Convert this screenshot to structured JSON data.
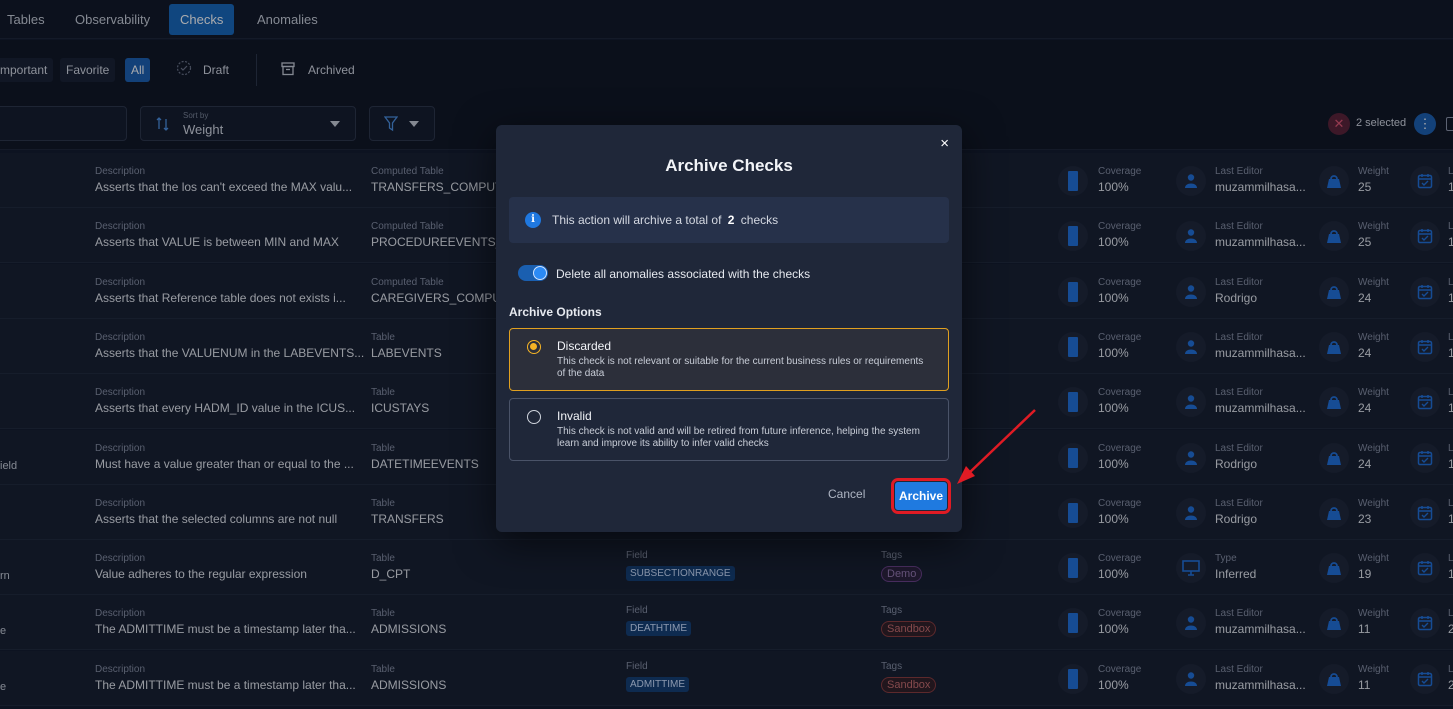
{
  "nav": {
    "tabs": [
      {
        "label": "Tables"
      },
      {
        "label": "Observability"
      },
      {
        "label": "Checks"
      },
      {
        "label": "Anomalies"
      }
    ]
  },
  "filters": {
    "important": "mportant",
    "favorite": "Favorite",
    "all": "All",
    "draft": "Draft",
    "archived": "Archived"
  },
  "toolbar": {
    "sort_label": "Sort by",
    "sort_value": "Weight",
    "selected_count": "2 selected"
  },
  "rows": [
    {
      "left": "",
      "desc": "Asserts that the los can't exceed the MAX valu...",
      "tlabel": "Computed Table",
      "table": "TRANSFERS_COMPUTE",
      "field": "",
      "tag": "",
      "coverage": "100%",
      "elabel": "Last Editor",
      "editor": "muzammilhasa...",
      "weight": "25",
      "flag": "1"
    },
    {
      "left": "",
      "desc": "Asserts that VALUE is between MIN and MAX",
      "tlabel": "Computed Table",
      "table": "PROCEDUREEVENTS_M",
      "field": "",
      "tag": "",
      "coverage": "100%",
      "elabel": "Last Editor",
      "editor": "muzammilhasa...",
      "weight": "25",
      "flag": "1"
    },
    {
      "left": "",
      "desc": "Asserts that Reference table does not exists i...",
      "tlabel": "Computed Table",
      "table": "CAREGIVERS_COMPUT",
      "field": "",
      "tag": "",
      "coverage": "100%",
      "elabel": "Last Editor",
      "editor": "Rodrigo",
      "weight": "24",
      "flag": "1"
    },
    {
      "left": "",
      "desc": "Asserts that the VALUENUM in the LABEVENTS...",
      "tlabel": "Table",
      "table": "LABEVENTS",
      "field": "",
      "tag": "",
      "coverage": "100%",
      "elabel": "Last Editor",
      "editor": "muzammilhasa...",
      "weight": "24",
      "flag": "1"
    },
    {
      "left": "",
      "desc": "Asserts that every HADM_ID value in the ICUS...",
      "tlabel": "Table",
      "table": "ICUSTAYS",
      "field": "",
      "tag": "",
      "coverage": "100%",
      "elabel": "Last Editor",
      "editor": "muzammilhasa...",
      "weight": "24",
      "flag": "1"
    },
    {
      "left": "ield",
      "desc": "Must have a value greater than or equal to the ...",
      "tlabel": "Table",
      "table": "DATETIMEEVENTS",
      "field": "",
      "tag": "",
      "coverage": "100%",
      "elabel": "Last Editor",
      "editor": "Rodrigo",
      "weight": "24",
      "flag": "1"
    },
    {
      "left": "",
      "desc": "Asserts that the selected columns are not null",
      "tlabel": "Table",
      "table": "TRANSFERS",
      "field": "",
      "tag": "",
      "coverage": "100%",
      "elabel": "Last Editor",
      "editor": "Rodrigo",
      "weight": "23",
      "flag": "1"
    },
    {
      "left": "rn",
      "desc": "Value adheres to the regular expression",
      "tlabel": "Table",
      "table": "D_CPT",
      "field": "SUBSECTIONRANGE",
      "tag": "Demo",
      "coverage": "100%",
      "elabel": "Type",
      "editor": "Inferred",
      "weight": "19",
      "flag": "1"
    },
    {
      "left": "e",
      "desc": "The ADMITTIME must be a timestamp later tha...",
      "tlabel": "Table",
      "table": "ADMISSIONS",
      "field": "DEATHTIME",
      "tag": "Sandbox",
      "coverage": "100%",
      "elabel": "Last Editor",
      "editor": "muzammilhasa...",
      "weight": "11",
      "flag": "2"
    },
    {
      "left": "e",
      "desc": "The ADMITTIME must be a timestamp later tha...",
      "tlabel": "Table",
      "table": "ADMISSIONS",
      "field": "ADMITTIME",
      "tag": "Sandbox",
      "coverage": "100%",
      "elabel": "Last Editor",
      "editor": "muzammilhasa...",
      "weight": "11",
      "flag": "2"
    }
  ],
  "labels": {
    "description": "Description",
    "field": "Field",
    "tags": "Tags",
    "coverage": "Coverage",
    "weight": "Weight",
    "last": "L"
  },
  "modal": {
    "title": "Archive Checks",
    "info_prefix": "This action will archive a total of",
    "info_count": "2",
    "info_suffix": "checks",
    "toggle_label": "Delete all anomalies associated with the checks",
    "section": "Archive Options",
    "options": [
      {
        "title": "Discarded",
        "desc": "This check is not relevant or suitable for the current business rules or requirements of the data"
      },
      {
        "title": "Invalid",
        "desc": "This check is not valid and will be retired from future inference, helping the system learn and improve its ability to infer valid checks"
      }
    ],
    "cancel": "Cancel",
    "archive": "Archive",
    "close": "×"
  },
  "colors": {
    "accent": "#1f7ae0",
    "selected_option": "#e0a020",
    "highlight": "#e01b24"
  }
}
